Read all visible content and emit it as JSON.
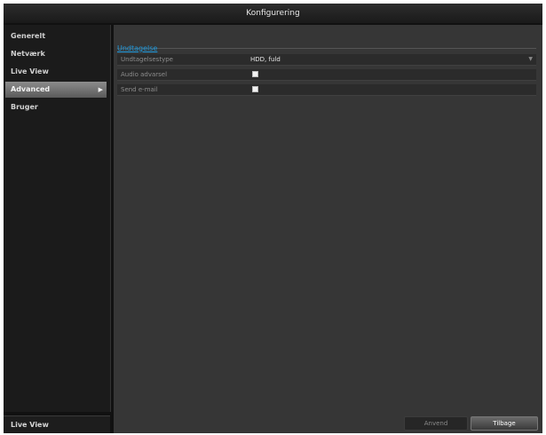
{
  "window": {
    "title": "Konfigurering"
  },
  "sidebar": {
    "items": [
      {
        "label": "Generelt"
      },
      {
        "label": "Netværk"
      },
      {
        "label": "Live View"
      },
      {
        "label": "Advanced",
        "active": true
      },
      {
        "label": "Bruger"
      }
    ],
    "bottom_label": "Live View"
  },
  "main": {
    "section_title": "Undtagelse",
    "rows": [
      {
        "label": "Undtagelsestype",
        "value": "HDD, fuld"
      },
      {
        "label": "Audio advarsel",
        "checked": true
      },
      {
        "label": "Send e-mail",
        "checked": true
      }
    ]
  },
  "buttons": {
    "secondary_label": "Anvend",
    "primary_label": "Tilbage"
  }
}
